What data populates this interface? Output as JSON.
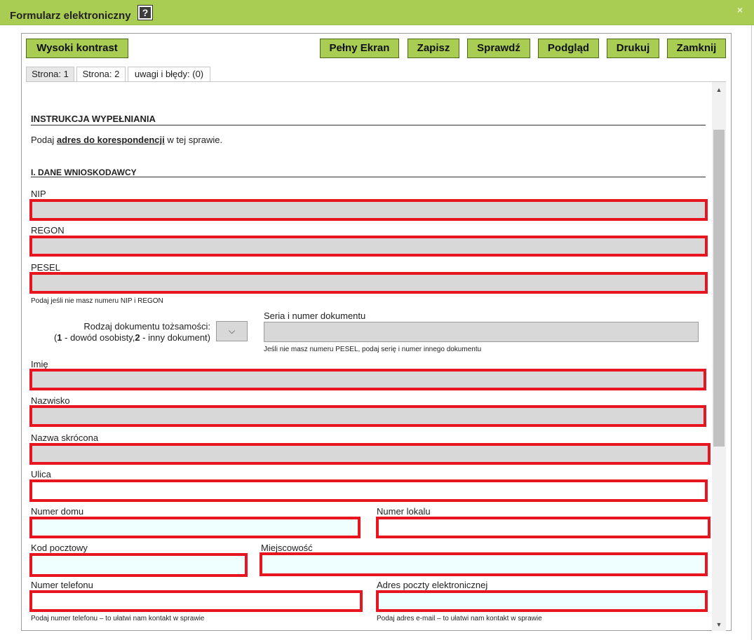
{
  "window": {
    "title": "Formularz elektroniczny",
    "help_glyph": "?",
    "close_glyph": "×"
  },
  "toolbar": {
    "high_contrast": "Wysoki kontrast",
    "fullscreen": "Pełny Ekran",
    "save": "Zapisz",
    "check": "Sprawdź",
    "preview": "Podgląd",
    "print": "Drukuj",
    "close": "Zamknij"
  },
  "tabs": [
    "Strona: 1",
    "Strona: 2",
    "uwagi i błędy: (0)"
  ],
  "instructions": {
    "heading": "INSTRUKCJA WYPEŁNIANIA",
    "text_before": "Podaj ",
    "text_bold": "adres do korespondencji",
    "text_after": " w tej sprawie."
  },
  "section1": {
    "heading": "I. DANE WNIOSKODAWCY",
    "nip_label": "NIP",
    "regon_label": "REGON",
    "pesel_label": "PESEL",
    "pesel_hint": "Podaj jeśli nie masz numeru NIP i REGON",
    "doc_type_label_line1": "Rodzaj dokumentu tożsamości:",
    "doc_type_label_line2_num1": "1",
    "doc_type_label_line2_mid": " - dowód osobisty,",
    "doc_type_label_line2_num2": "2",
    "doc_type_label_line2_end": " - inny dokument)",
    "doc_type_paren": "(",
    "doc_series_label": "Seria i numer dokumentu",
    "doc_series_hint": "Jeśli nie masz numeru PESEL, podaj serię i numer innego dokumentu",
    "first_name_label": "Imię",
    "last_name_label": "Nazwisko",
    "short_name_label": "Nazwa skrócona",
    "street_label": "Ulica",
    "house_no_label": "Numer domu",
    "flat_no_label": "Numer lokalu",
    "postal_code_label": "Kod pocztowy",
    "city_label": "Miejscowość",
    "phone_label": "Numer telefonu",
    "phone_hint": "Podaj numer telefonu – to ułatwi nam kontakt w sprawie",
    "email_label": "Adres poczty elektronicznej",
    "email_hint": "Podaj adres e-mail – to ułatwi nam kontakt w sprawie"
  },
  "colors": {
    "titlebar": "#a9cc52",
    "button": "#a9cc52",
    "error_border": "#e8141f",
    "readonly_field": "#d8d8d8",
    "editable_field": "#efffff"
  }
}
